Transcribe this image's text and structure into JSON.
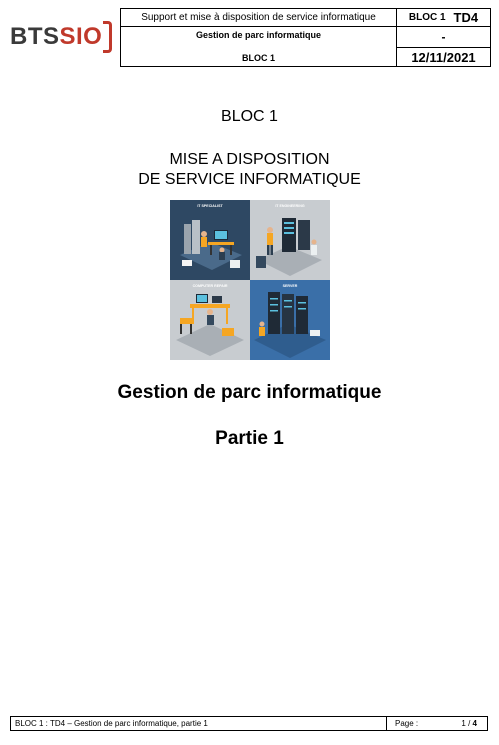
{
  "header": {
    "logo_bts": "BTS",
    "logo_sio": "SIO",
    "title": "Support et mise à disposition de service informatique",
    "subtitle": "Gestion de parc informatique",
    "bloc": "BLOC 1",
    "code_bloc": "BLOC 1",
    "code_td": "TD4",
    "dash": "-",
    "date": "12/11/2021"
  },
  "body": {
    "bloc_heading": "BLOC 1",
    "mise_line1": "MISE A DISPOSITION",
    "mise_line2": "DE SERVICE INFORMATIQUE",
    "illustration": {
      "panels": [
        "IT SPECIALIST",
        "IT ENGINEERING",
        "COMPUTER REPAIR",
        "SERVER"
      ],
      "colors": {
        "dark_navy": "#2e4863",
        "light_grey": "#c8ccd0",
        "blue": "#3a6fa8",
        "orange": "#f5a623"
      }
    },
    "title": "Gestion de parc informatique",
    "part": "Partie 1"
  },
  "footer": {
    "left": "BLOC 1 : TD4 – Gestion de parc informatique, partie 1",
    "page_label": "Page :",
    "page_current": "1",
    "page_sep": "/",
    "page_total": "4"
  }
}
